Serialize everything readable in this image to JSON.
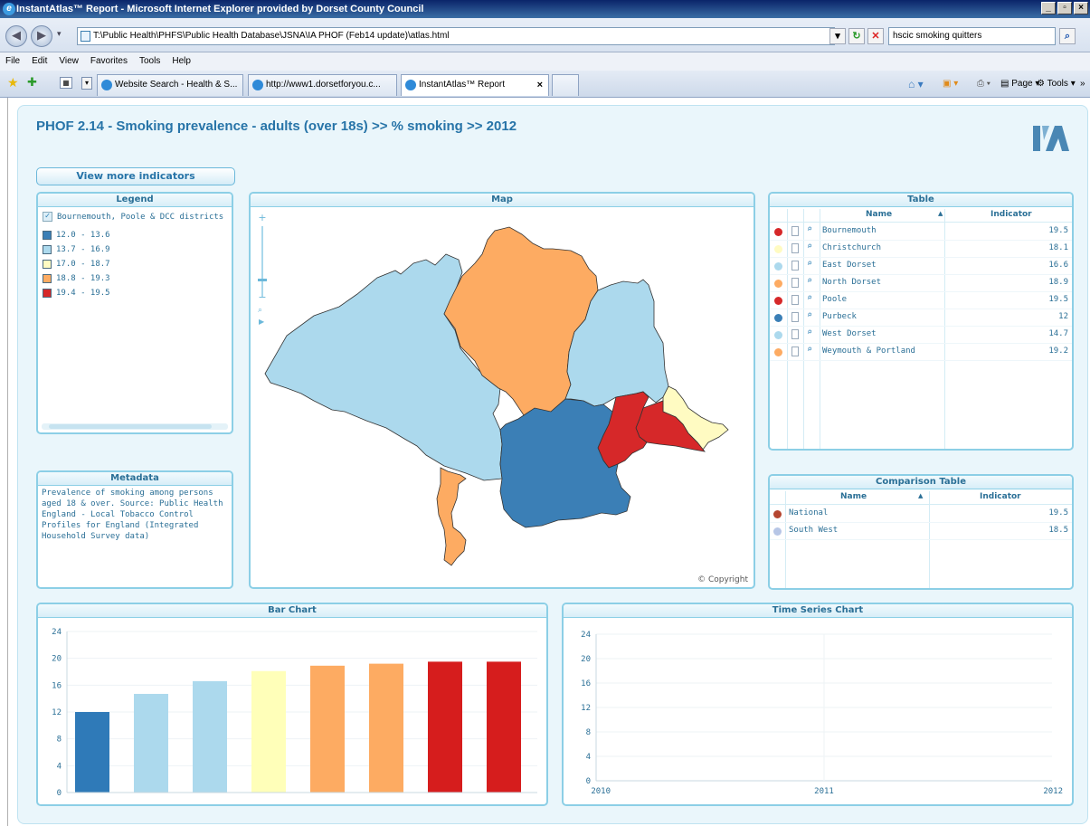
{
  "browser": {
    "window_title": "InstantAtlas™ Report - Microsoft Internet Explorer provided by Dorset County Council",
    "address": "T:\\Public Health\\PHFS\\Public Health Database\\JSNA\\IA PHOF (Feb14 update)\\atlas.html",
    "search_value": "hscic smoking quitters",
    "menu": [
      "File",
      "Edit",
      "View",
      "Favorites",
      "Tools",
      "Help"
    ],
    "tabs": [
      {
        "label": "Website Search - Health & S..."
      },
      {
        "label": "http://www1.dorsetforyou.c..."
      },
      {
        "label": "InstantAtlas™ Report"
      }
    ],
    "command_labels": {
      "page": "Page",
      "tools": "Tools"
    }
  },
  "report": {
    "title": "PHOF 2.14 - Smoking prevalence - adults (over 18s) >> % smoking >>  2012",
    "logo_text": "IA",
    "more_indicators_label": "View more indicators"
  },
  "legend": {
    "title": "Legend",
    "layer_label": "Bournemouth, Poole & DCC districts",
    "classes": [
      {
        "label": "12.0 - 13.6",
        "color": "#3b7fb6"
      },
      {
        "label": "13.7 - 16.9",
        "color": "#acd9ed"
      },
      {
        "label": "17.0 - 18.7",
        "color": "#fffbc2"
      },
      {
        "label": "18.8 - 19.3",
        "color": "#fdab62"
      },
      {
        "label": "19.4 - 19.5",
        "color": "#d62829"
      }
    ]
  },
  "metadata": {
    "title": "Metadata",
    "text": "Prevalence of smoking among persons aged 18 & over. Source: Public Health England - Local Tobacco Control Profiles for England (Integrated Household Survey data)"
  },
  "map": {
    "title": "Map",
    "copyright": "© Copyright"
  },
  "table": {
    "title": "Table",
    "col_name": "Name",
    "col_indicator": "Indicator",
    "rows": [
      {
        "name": "Bournemouth",
        "value": "19.5",
        "color": "#d62829"
      },
      {
        "name": "Christchurch",
        "value": "18.1",
        "color": "#fffbc2"
      },
      {
        "name": "East Dorset",
        "value": "16.6",
        "color": "#acd9ed"
      },
      {
        "name": "North Dorset",
        "value": "18.9",
        "color": "#fdab62"
      },
      {
        "name": "Poole",
        "value": "19.5",
        "color": "#d62829"
      },
      {
        "name": "Purbeck",
        "value": "12",
        "color": "#3b7fb6"
      },
      {
        "name": "West Dorset",
        "value": "14.7",
        "color": "#acd9ed"
      },
      {
        "name": "Weymouth & Portland",
        "value": "19.2",
        "color": "#fdab62"
      }
    ]
  },
  "comparison": {
    "title": "Comparison Table",
    "col_name": "Name",
    "col_indicator": "Indicator",
    "rows": [
      {
        "name": "National",
        "value": "19.5",
        "color": "#b5452f"
      },
      {
        "name": "South West",
        "value": "18.5",
        "color": "#b7c6e6"
      }
    ]
  },
  "bar_chart": {
    "title": "Bar Chart"
  },
  "time_series": {
    "title": "Time Series Chart"
  },
  "chart_data": [
    {
      "type": "bar",
      "title": "Bar Chart",
      "yticks": [
        0,
        4,
        8,
        12,
        16,
        20,
        24
      ],
      "ylim": [
        0,
        24
      ],
      "grid": true,
      "bars": [
        {
          "value": 12,
          "color": "#2f7ab8"
        },
        {
          "value": 14.7,
          "color": "#acd9ed"
        },
        {
          "value": 16.6,
          "color": "#acd9ed"
        },
        {
          "value": 18.1,
          "color": "#ffffb9"
        },
        {
          "value": 18.9,
          "color": "#fdab62"
        },
        {
          "value": 19.2,
          "color": "#fdab62"
        },
        {
          "value": 19.5,
          "color": "#d61d1d"
        },
        {
          "value": 19.5,
          "color": "#d61d1d"
        }
      ]
    },
    {
      "type": "line",
      "title": "Time Series Chart",
      "yticks": [
        0,
        4,
        8,
        12,
        16,
        20,
        24
      ],
      "ylim": [
        0,
        24
      ],
      "xticks": [
        "2010",
        "2011",
        "2012"
      ],
      "grid": true,
      "series": []
    }
  ]
}
